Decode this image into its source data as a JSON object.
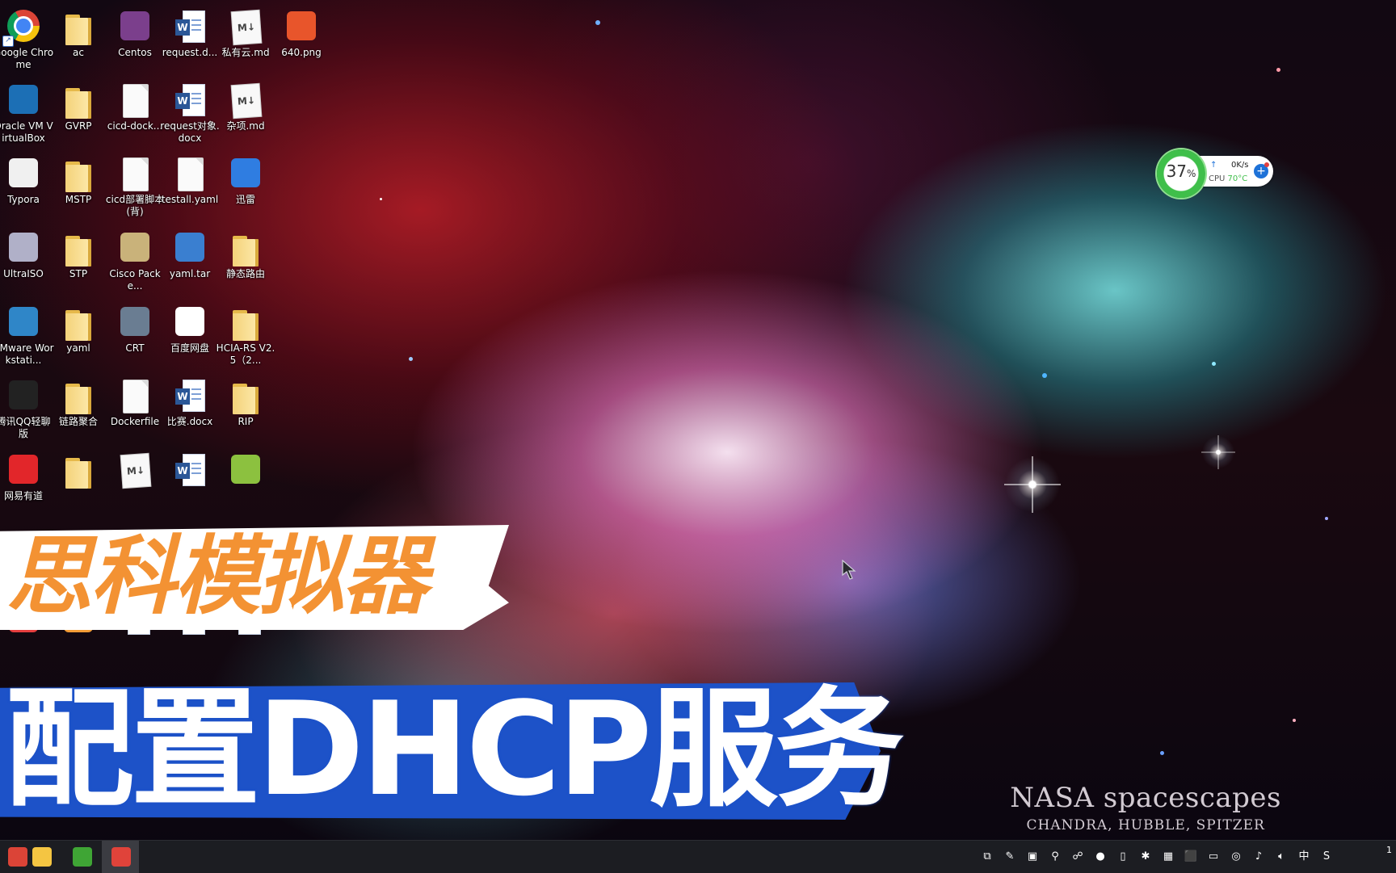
{
  "desktop": {
    "icons": [
      {
        "label": "Google Chrome",
        "kind": "chrome"
      },
      {
        "label": "ac",
        "kind": "folder"
      },
      {
        "label": "Centos",
        "kind": "generic",
        "color": "#7b3f8c"
      },
      {
        "label": "request.d...",
        "kind": "word"
      },
      {
        "label": "私有云.md",
        "kind": "md"
      },
      {
        "label": "640.png",
        "kind": "generic",
        "color": "#e8552b"
      },
      {
        "label": "Oracle VM VirtualBox",
        "kind": "generic",
        "color": "#1c6fb5"
      },
      {
        "label": "GVRP",
        "kind": "folder"
      },
      {
        "label": "cicd-dock...",
        "kind": "doc"
      },
      {
        "label": "request对象.docx",
        "kind": "word"
      },
      {
        "label": "杂项.md",
        "kind": "md"
      },
      {
        "label": "Typora",
        "kind": "generic",
        "color": "#f0f0f0"
      },
      {
        "label": "MSTP",
        "kind": "folder"
      },
      {
        "label": "cicd部署脚本(背)",
        "kind": "doc"
      },
      {
        "label": "testall.yaml",
        "kind": "doc"
      },
      {
        "label": "迅雷",
        "kind": "generic",
        "color": "#2f7de1"
      },
      {
        "label": "UltraISO",
        "kind": "generic",
        "color": "#b0b0c8"
      },
      {
        "label": "STP",
        "kind": "folder"
      },
      {
        "label": "Cisco Packe...",
        "kind": "generic",
        "color": "#c9b27a"
      },
      {
        "label": "yaml.tar",
        "kind": "generic",
        "color": "#3a7fd0"
      },
      {
        "label": "静态路由",
        "kind": "folder"
      },
      {
        "label": "VMware Workstati...",
        "kind": "generic",
        "color": "#2f86c8"
      },
      {
        "label": "yaml",
        "kind": "folder"
      },
      {
        "label": "CRT",
        "kind": "generic",
        "color": "#6a7d92"
      },
      {
        "label": "百度网盘",
        "kind": "generic",
        "color": "#ffffff"
      },
      {
        "label": "HCIA-RS V2.5（2...",
        "kind": "folder"
      },
      {
        "label": "腾讯QQ轻聊版",
        "kind": "generic",
        "color": "#222222"
      },
      {
        "label": "链路聚合",
        "kind": "folder"
      },
      {
        "label": "Dockerfile",
        "kind": "doc"
      },
      {
        "label": "比赛.docx",
        "kind": "word"
      },
      {
        "label": "RIP",
        "kind": "folder"
      },
      {
        "label": "网易有道",
        "kind": "generic",
        "color": "#e2262a"
      },
      {
        "label": "",
        "kind": "folder"
      },
      {
        "label": "",
        "kind": "md"
      },
      {
        "label": "",
        "kind": "word"
      },
      {
        "label": "",
        "kind": "generic",
        "color": "#8cc13f"
      },
      {
        "label": "",
        "kind": "generic",
        "color": "#e63e3e"
      },
      {
        "label": "",
        "kind": "generic",
        "color": "#f39c36"
      },
      {
        "label": "",
        "kind": "word"
      },
      {
        "label": "",
        "kind": "word"
      },
      {
        "label": "",
        "kind": "word"
      }
    ]
  },
  "overlay": {
    "title_orange": "思科模拟器",
    "title_main": "配置DHCP服务"
  },
  "watermark": {
    "title": "NASA spacescapes",
    "subtitle": "CHANDRA, HUBBLE, SPITZER"
  },
  "widget": {
    "percent": "37",
    "percent_unit": "%",
    "up_arrow": "↑",
    "speed": "0K/s",
    "cpu_label": "CPU",
    "cpu_temp": "70°C"
  },
  "taskbar": {
    "apps": [
      {
        "name": "chrome-taskbar",
        "color": "#db4437"
      },
      {
        "name": "file-explorer-taskbar",
        "color": "#f4c542"
      },
      {
        "name": "camtasia-taskbar",
        "color": "#3fa535"
      },
      {
        "name": "recorder-taskbar",
        "color": "#e0433a"
      }
    ],
    "tray": [
      "⧉",
      "✎",
      "▣",
      "⚲",
      "☍",
      "●",
      "▯",
      "✱",
      "▦",
      "⬛",
      "▭",
      "◎",
      "♪",
      "🔈︎",
      "中",
      "S"
    ],
    "ime": "中",
    "clock": "1"
  }
}
